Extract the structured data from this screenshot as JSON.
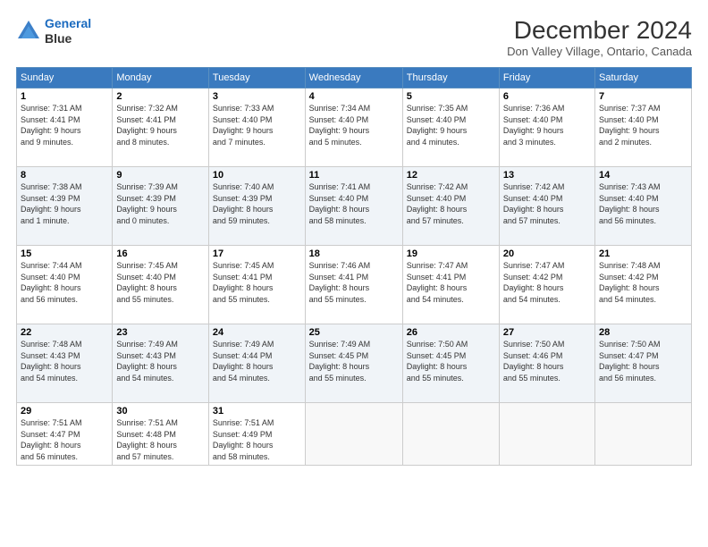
{
  "header": {
    "logo_line1": "General",
    "logo_line2": "Blue",
    "title": "December 2024",
    "location": "Don Valley Village, Ontario, Canada"
  },
  "days_of_week": [
    "Sunday",
    "Monday",
    "Tuesday",
    "Wednesday",
    "Thursday",
    "Friday",
    "Saturday"
  ],
  "weeks": [
    [
      {
        "day": "1",
        "info": "Sunrise: 7:31 AM\nSunset: 4:41 PM\nDaylight: 9 hours\nand 9 minutes."
      },
      {
        "day": "2",
        "info": "Sunrise: 7:32 AM\nSunset: 4:41 PM\nDaylight: 9 hours\nand 8 minutes."
      },
      {
        "day": "3",
        "info": "Sunrise: 7:33 AM\nSunset: 4:40 PM\nDaylight: 9 hours\nand 7 minutes."
      },
      {
        "day": "4",
        "info": "Sunrise: 7:34 AM\nSunset: 4:40 PM\nDaylight: 9 hours\nand 5 minutes."
      },
      {
        "day": "5",
        "info": "Sunrise: 7:35 AM\nSunset: 4:40 PM\nDaylight: 9 hours\nand 4 minutes."
      },
      {
        "day": "6",
        "info": "Sunrise: 7:36 AM\nSunset: 4:40 PM\nDaylight: 9 hours\nand 3 minutes."
      },
      {
        "day": "7",
        "info": "Sunrise: 7:37 AM\nSunset: 4:40 PM\nDaylight: 9 hours\nand 2 minutes."
      }
    ],
    [
      {
        "day": "8",
        "info": "Sunrise: 7:38 AM\nSunset: 4:39 PM\nDaylight: 9 hours\nand 1 minute."
      },
      {
        "day": "9",
        "info": "Sunrise: 7:39 AM\nSunset: 4:39 PM\nDaylight: 9 hours\nand 0 minutes."
      },
      {
        "day": "10",
        "info": "Sunrise: 7:40 AM\nSunset: 4:39 PM\nDaylight: 8 hours\nand 59 minutes."
      },
      {
        "day": "11",
        "info": "Sunrise: 7:41 AM\nSunset: 4:40 PM\nDaylight: 8 hours\nand 58 minutes."
      },
      {
        "day": "12",
        "info": "Sunrise: 7:42 AM\nSunset: 4:40 PM\nDaylight: 8 hours\nand 57 minutes."
      },
      {
        "day": "13",
        "info": "Sunrise: 7:42 AM\nSunset: 4:40 PM\nDaylight: 8 hours\nand 57 minutes."
      },
      {
        "day": "14",
        "info": "Sunrise: 7:43 AM\nSunset: 4:40 PM\nDaylight: 8 hours\nand 56 minutes."
      }
    ],
    [
      {
        "day": "15",
        "info": "Sunrise: 7:44 AM\nSunset: 4:40 PM\nDaylight: 8 hours\nand 56 minutes."
      },
      {
        "day": "16",
        "info": "Sunrise: 7:45 AM\nSunset: 4:40 PM\nDaylight: 8 hours\nand 55 minutes."
      },
      {
        "day": "17",
        "info": "Sunrise: 7:45 AM\nSunset: 4:41 PM\nDaylight: 8 hours\nand 55 minutes."
      },
      {
        "day": "18",
        "info": "Sunrise: 7:46 AM\nSunset: 4:41 PM\nDaylight: 8 hours\nand 55 minutes."
      },
      {
        "day": "19",
        "info": "Sunrise: 7:47 AM\nSunset: 4:41 PM\nDaylight: 8 hours\nand 54 minutes."
      },
      {
        "day": "20",
        "info": "Sunrise: 7:47 AM\nSunset: 4:42 PM\nDaylight: 8 hours\nand 54 minutes."
      },
      {
        "day": "21",
        "info": "Sunrise: 7:48 AM\nSunset: 4:42 PM\nDaylight: 8 hours\nand 54 minutes."
      }
    ],
    [
      {
        "day": "22",
        "info": "Sunrise: 7:48 AM\nSunset: 4:43 PM\nDaylight: 8 hours\nand 54 minutes."
      },
      {
        "day": "23",
        "info": "Sunrise: 7:49 AM\nSunset: 4:43 PM\nDaylight: 8 hours\nand 54 minutes."
      },
      {
        "day": "24",
        "info": "Sunrise: 7:49 AM\nSunset: 4:44 PM\nDaylight: 8 hours\nand 54 minutes."
      },
      {
        "day": "25",
        "info": "Sunrise: 7:49 AM\nSunset: 4:45 PM\nDaylight: 8 hours\nand 55 minutes."
      },
      {
        "day": "26",
        "info": "Sunrise: 7:50 AM\nSunset: 4:45 PM\nDaylight: 8 hours\nand 55 minutes."
      },
      {
        "day": "27",
        "info": "Sunrise: 7:50 AM\nSunset: 4:46 PM\nDaylight: 8 hours\nand 55 minutes."
      },
      {
        "day": "28",
        "info": "Sunrise: 7:50 AM\nSunset: 4:47 PM\nDaylight: 8 hours\nand 56 minutes."
      }
    ],
    [
      {
        "day": "29",
        "info": "Sunrise: 7:51 AM\nSunset: 4:47 PM\nDaylight: 8 hours\nand 56 minutes."
      },
      {
        "day": "30",
        "info": "Sunrise: 7:51 AM\nSunset: 4:48 PM\nDaylight: 8 hours\nand 57 minutes."
      },
      {
        "day": "31",
        "info": "Sunrise: 7:51 AM\nSunset: 4:49 PM\nDaylight: 8 hours\nand 58 minutes."
      },
      {
        "day": "",
        "info": ""
      },
      {
        "day": "",
        "info": ""
      },
      {
        "day": "",
        "info": ""
      },
      {
        "day": "",
        "info": ""
      }
    ]
  ]
}
